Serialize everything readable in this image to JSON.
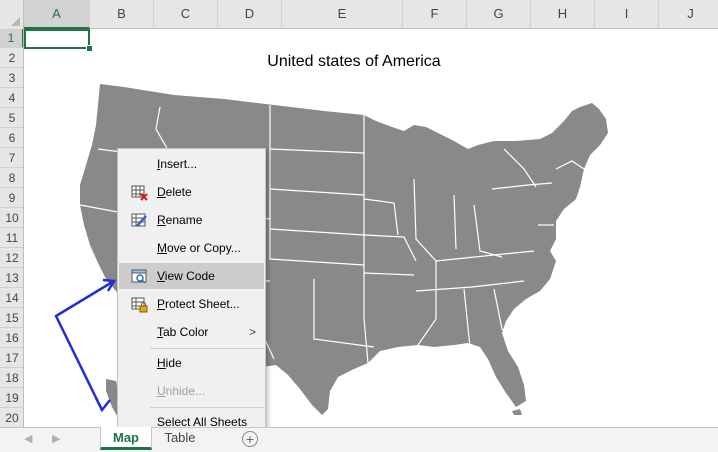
{
  "columns": [
    "A",
    "B",
    "C",
    "D",
    "E",
    "F",
    "G",
    "H",
    "I",
    "J"
  ],
  "rows": [
    "1",
    "2",
    "3",
    "4",
    "5",
    "6",
    "7",
    "8",
    "9",
    "10",
    "11",
    "12",
    "13",
    "14",
    "15",
    "16",
    "17",
    "18",
    "19",
    "20"
  ],
  "selected_cell": "A1",
  "chart_title": "United states of America",
  "map": {
    "fill_color": "#8a8889",
    "border_color": "#ffffff"
  },
  "context_menu": {
    "items": [
      {
        "label": "Insert...",
        "underline": "I",
        "icon": null
      },
      {
        "label": "Delete",
        "underline": "D",
        "icon": "delete-sheet-icon"
      },
      {
        "label": "Rename",
        "underline": "R",
        "icon": "rename-sheet-icon"
      },
      {
        "label": "Move or Copy...",
        "underline": "M",
        "icon": null
      },
      {
        "label": "View Code",
        "underline": "V",
        "icon": "view-code-icon",
        "highlighted": true
      },
      {
        "label": "Protect Sheet...",
        "underline": "P",
        "icon": "protect-sheet-icon"
      },
      {
        "label": "Tab Color",
        "underline": "T",
        "icon": null,
        "submenu": true
      },
      {
        "label": "Hide",
        "underline": "H",
        "icon": null
      },
      {
        "label": "Unhide...",
        "underline": "U",
        "icon": null,
        "disabled": true
      },
      {
        "label": "Select All Sheets",
        "underline": "S",
        "icon": null
      }
    ],
    "submenu_arrow": ">"
  },
  "sheet_tabs": [
    {
      "label": "Map",
      "active": true
    },
    {
      "label": "Table",
      "active": false
    }
  ],
  "add_sheet_symbol": "+",
  "nav_left": "◀",
  "nav_right": "▶",
  "colors": {
    "accent": "#217346",
    "arrow": "#1f2fd8"
  }
}
